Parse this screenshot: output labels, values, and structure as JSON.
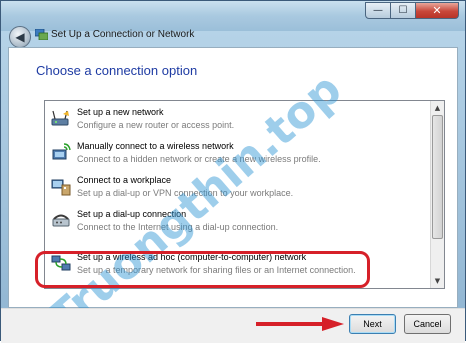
{
  "window": {
    "title": "Set Up a Connection or Network",
    "close_glyph": "✕",
    "minimize_glyph": "—",
    "maximize_glyph": "☐",
    "back_glyph": "◀"
  },
  "main": {
    "heading": "Choose a connection option",
    "options": [
      {
        "title": "Set up a new network",
        "desc": "Configure a new router or access point.",
        "icon": "router-network-icon"
      },
      {
        "title": "Manually connect to a wireless network",
        "desc": "Connect to a hidden network or create a new wireless profile.",
        "icon": "wireless-network-icon"
      },
      {
        "title": "Connect to a workplace",
        "desc": "Set up a dial-up or VPN connection to your workplace.",
        "icon": "workplace-connection-icon"
      },
      {
        "title": "Set up a dial-up connection",
        "desc": "Connect to the Internet using a dial-up connection.",
        "icon": "dialup-modem-icon"
      },
      {
        "title": "Set up a wireless ad hoc (computer-to-computer) network",
        "desc": "Set up a temporary network for sharing files or an Internet connection.",
        "icon": "adhoc-network-icon"
      }
    ],
    "highlighted_option": 4,
    "highlight_color": "#d62029"
  },
  "footer": {
    "next_label": "Next",
    "cancel_label": "Cancel"
  },
  "watermark": {
    "text": "Truongthin.top",
    "color": "#2a93d5"
  }
}
